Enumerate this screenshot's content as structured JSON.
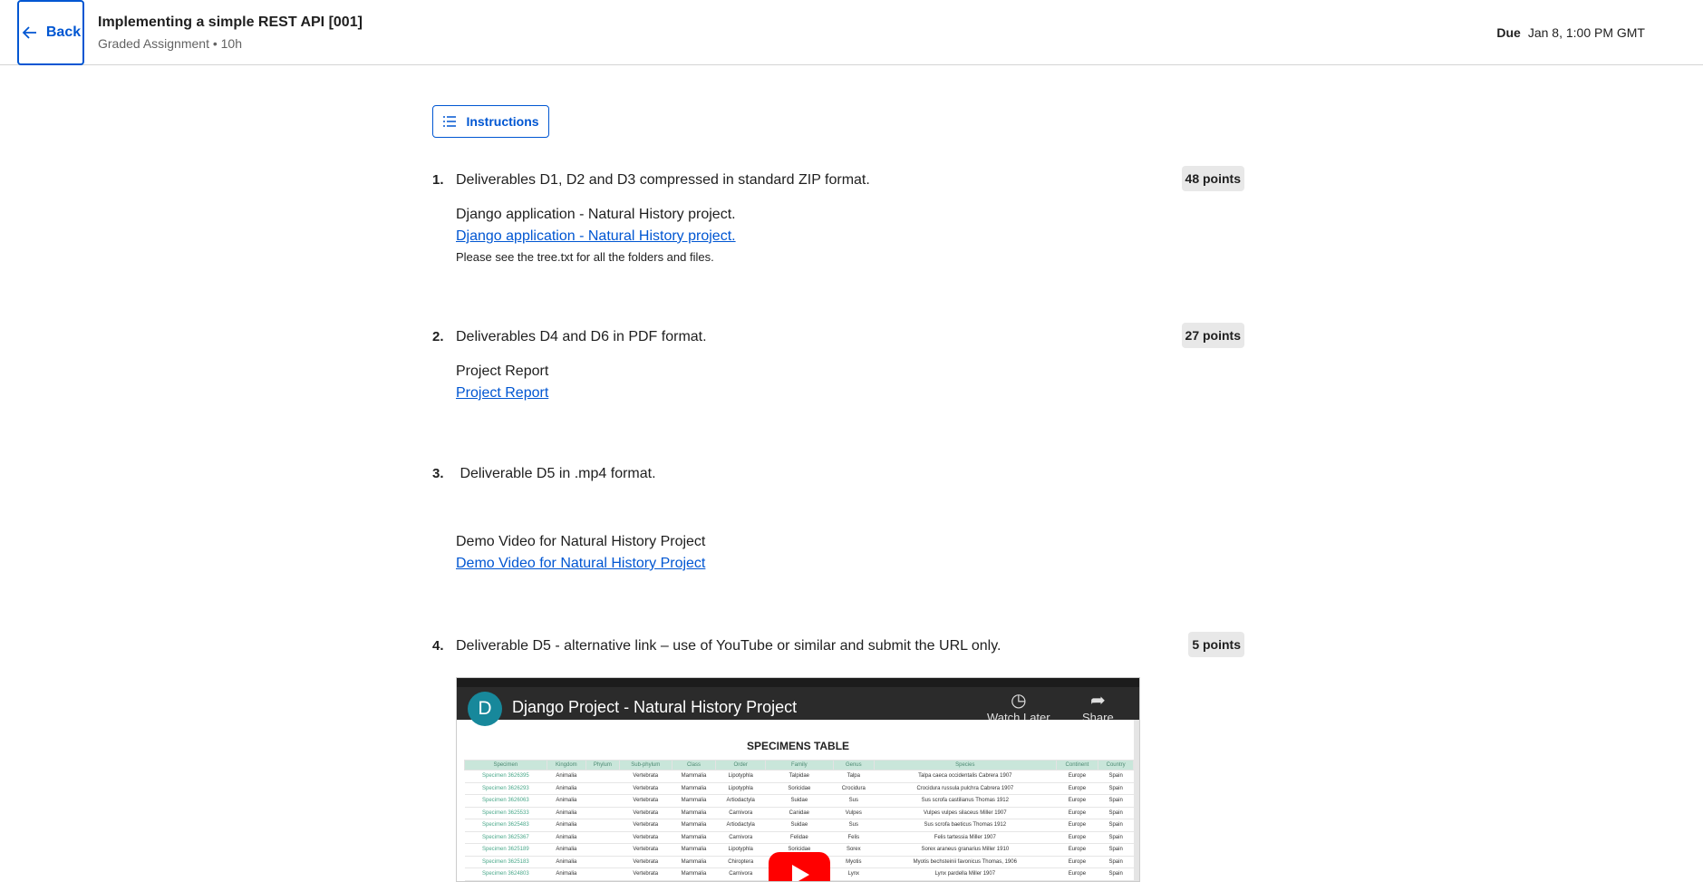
{
  "header": {
    "back_label": "Back",
    "title": "Implementing a simple REST API [001]",
    "subtitle": "Graded Assignment • 10h",
    "due_label": "Due",
    "due_value": "Jan 8, 1:00 PM GMT"
  },
  "instructions_label": "Instructions",
  "questions": [
    {
      "num": "1.",
      "text": "Deliverables D1, D2 and D3 compressed in standard ZIP format.",
      "points": "48 points",
      "label": "Django application - Natural History project.",
      "link": "Django application - Natural History project.",
      "note": "Please see the tree.txt for all the folders and files."
    },
    {
      "num": "2.",
      "text": "Deliverables D4 and D6 in PDF format.",
      "points": "27 points",
      "label": "Project Report",
      "link": "Project Report"
    },
    {
      "num": "3.",
      "text": " Deliverable D5 in .mp4 format.",
      "label": "Demo Video for Natural History Project",
      "link": "Demo Video for Natural History Project"
    },
    {
      "num": "4.",
      "text": "Deliverable D5 - alternative link – use of YouTube or similar and submit the URL only.",
      "points": "5 points"
    }
  ],
  "video": {
    "channel_initial": "D",
    "title": "Django Project - Natural History Project",
    "watch_later": "Watch Later",
    "share": "Share",
    "table_title": "SPECIMENS TABLE",
    "columns": [
      "Specimen",
      "Kingdom",
      "Phylum",
      "Sub-phylum",
      "Class",
      "Order",
      "Family",
      "Genus",
      "Species",
      "Continent",
      "Country"
    ],
    "rows": [
      [
        "Specimen 3626395",
        "Animalia",
        "",
        "Vertebrata",
        "Mammalia",
        "Lipotyphla",
        "Talpidae",
        "Talpa",
        "Talpa caeca occidentalis Cabrera 1907",
        "Europe",
        "Spain"
      ],
      [
        "Specimen 3626293",
        "Animalia",
        "",
        "Vertebrata",
        "Mammalia",
        "Lipotyphla",
        "Soricidae",
        "Crocidura",
        "Crocidura russula pulchra Cabrera 1907",
        "Europe",
        "Spain"
      ],
      [
        "Specimen 3626063",
        "Animalia",
        "",
        "Vertebrata",
        "Mammalia",
        "Artiodactyla",
        "Suidae",
        "Sus",
        "Sus scrofa castilianus Thomas 1912",
        "Europe",
        "Spain"
      ],
      [
        "Specimen 3625533",
        "Animalia",
        "",
        "Vertebrata",
        "Mammalia",
        "Carnivora",
        "Canidae",
        "Vulpes",
        "Vulpes vulpes silaceus Miller 1907",
        "Europe",
        "Spain"
      ],
      [
        "Specimen 3625483",
        "Animalia",
        "",
        "Vertebrata",
        "Mammalia",
        "Artiodactyla",
        "Suidae",
        "Sus",
        "Sus scrofa baeticus Thomas 1912",
        "Europe",
        "Spain"
      ],
      [
        "Specimen 3625367",
        "Animalia",
        "",
        "Vertebrata",
        "Mammalia",
        "Carnivora",
        "Felidae",
        "Felis",
        "Felis tartessia Miller 1907",
        "Europe",
        "Spain"
      ],
      [
        "Specimen 3625189",
        "Animalia",
        "",
        "Vertebrata",
        "Mammalia",
        "Lipotyphla",
        "Soricidae",
        "Sorex",
        "Sorex araneus granarius Miller 1910",
        "Europe",
        "Spain"
      ],
      [
        "Specimen 3625183",
        "Animalia",
        "",
        "Vertebrata",
        "Mammalia",
        "Chiroptera",
        "Vespertilionidae",
        "Myotis",
        "Myotis bechsteinii favonicus Thomas, 1906",
        "Europe",
        "Spain"
      ],
      [
        "Specimen 3624803",
        "Animalia",
        "",
        "Vertebrata",
        "Mammalia",
        "Carnivora",
        "Felidae",
        "Lynx",
        "Lynx pardella Miller 1907",
        "Europe",
        "Spain"
      ]
    ]
  }
}
